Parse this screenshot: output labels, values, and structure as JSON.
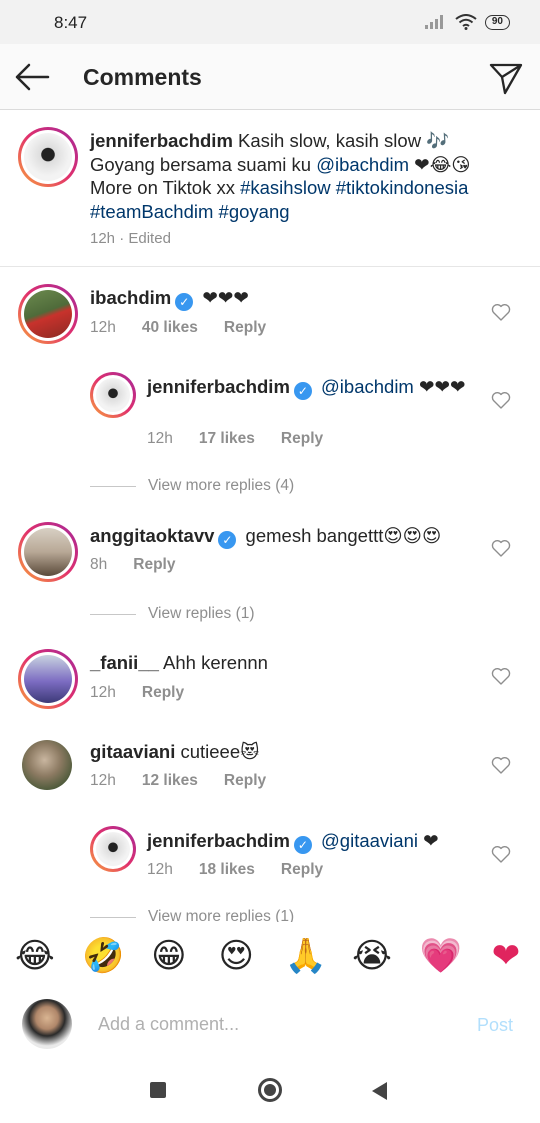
{
  "status_bar": {
    "time": "8:47",
    "battery": "90"
  },
  "header": {
    "title": "Comments"
  },
  "caption": {
    "username": "jenniferbachdim",
    "text_1": " Kasih slow, kasih slow 🎶 Goyang bersama suami ku ",
    "mention": "@ibachdim",
    "text_2": " ❤😂😘 More on Tiktok xx ",
    "hashtags": "#kasihslow #tiktokindonesia #teamBachdim #goyang",
    "time": "12h",
    "edited": "Edited"
  },
  "comments": [
    {
      "username": "ibachdim",
      "text": "❤❤❤",
      "time": "12h",
      "likes": "40 likes",
      "reply": "Reply"
    },
    {
      "username": "jenniferbachdim",
      "mention": "@ibachdim",
      "text": " ❤❤❤",
      "time": "12h",
      "likes": "17 likes",
      "reply": "Reply"
    },
    {
      "username": "anggitaoktavv",
      "text": "gemesh bangettt😍😍😍",
      "time": "8h",
      "reply": "Reply"
    },
    {
      "username": "_fanii__",
      "text": "Ahh kerennn",
      "time": "12h",
      "reply": "Reply"
    },
    {
      "username": "gitaaviani",
      "text": "cutieee😻",
      "time": "12h",
      "likes": "12 likes",
      "reply": "Reply"
    },
    {
      "username": "jenniferbachdim",
      "mention": "@gitaaviani",
      "text": " ❤",
      "time": "12h",
      "likes": "18 likes",
      "reply": "Reply"
    }
  ],
  "view_replies": {
    "more_4": "View more replies (4)",
    "replies_1": "View replies (1)",
    "more_1": "View more replies (1)"
  },
  "emoji_bar": [
    "😂",
    "🤣",
    "😁",
    "😍",
    "🙏",
    "😭",
    "💗",
    "❤"
  ],
  "composer": {
    "placeholder": "Add a comment...",
    "post": "Post"
  },
  "colors": {
    "link": "#00376b",
    "meta": "#8e8e8e",
    "verified": "#3897f0",
    "post_disabled": "#b2dffc"
  }
}
